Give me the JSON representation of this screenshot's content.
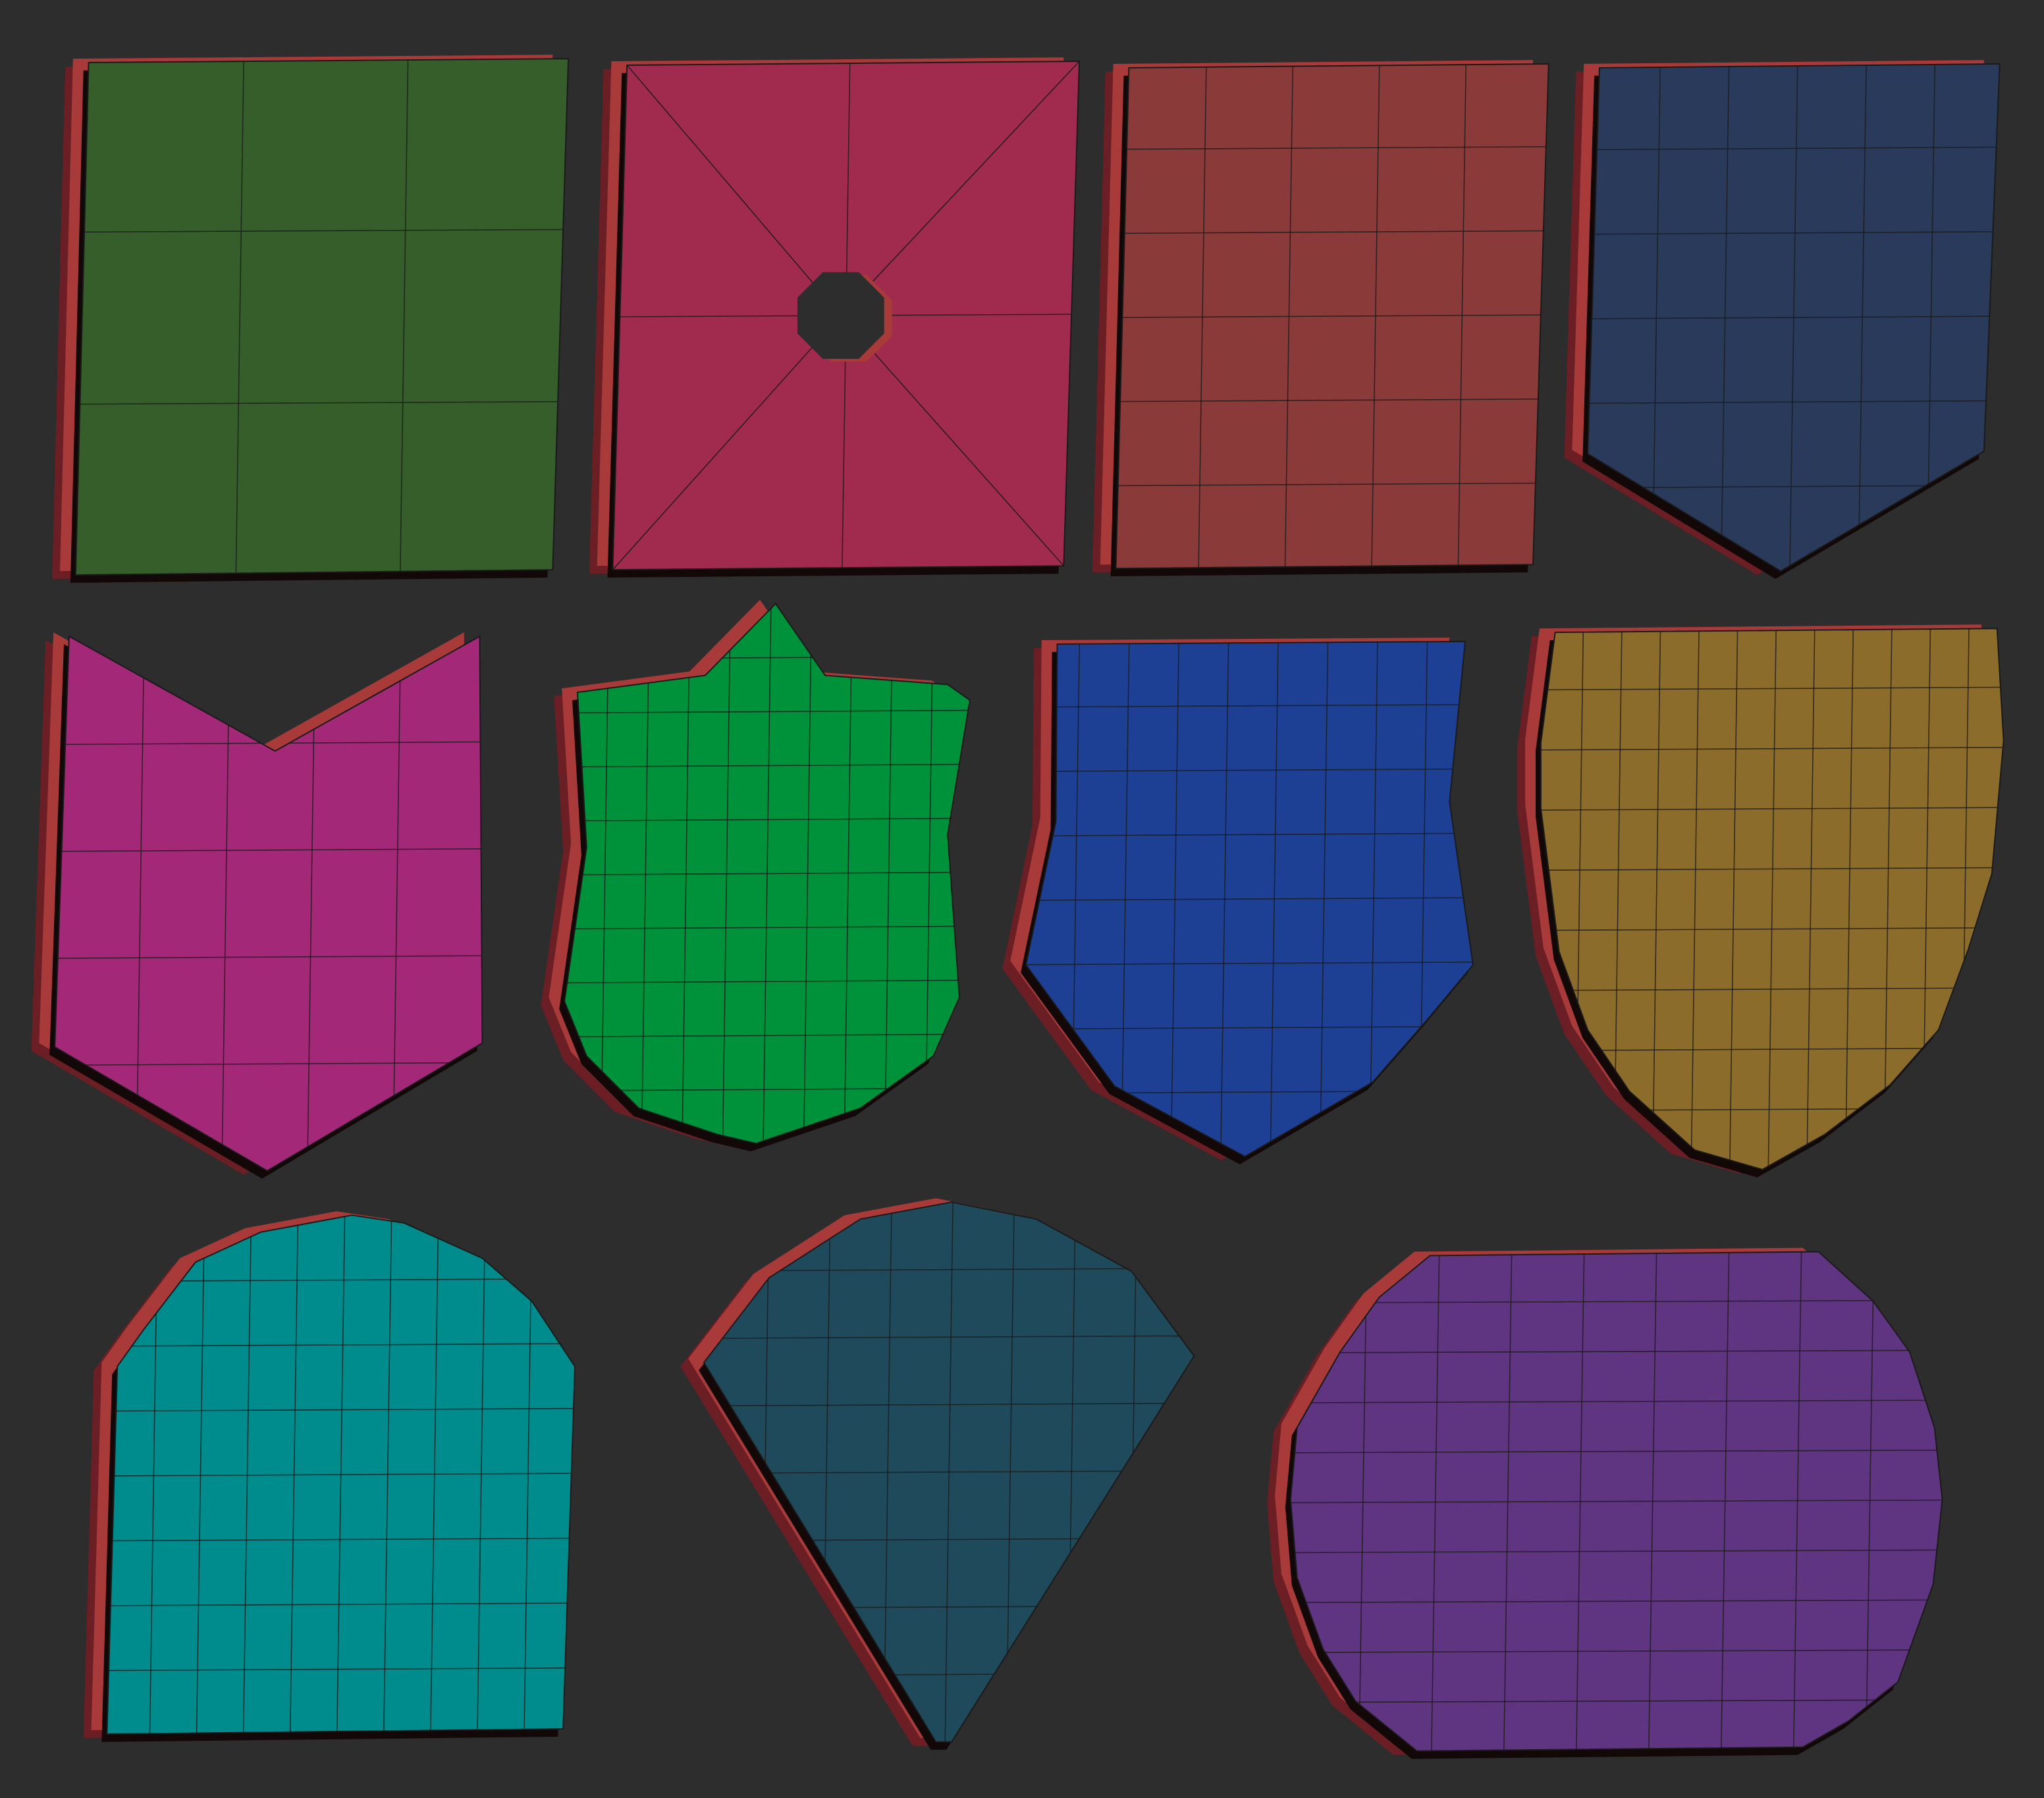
{
  "scene": {
    "background_color": "#2d2d2d",
    "side_color": "#6b1f24",
    "rim_color": "#a83a3a",
    "wire_color": "#1a1a1a"
  },
  "shields": [
    {
      "id": "square-green",
      "face_color": "#365e2b",
      "cols": 3,
      "rows": 3
    },
    {
      "id": "square-hole-pink",
      "face_color": "#a02b4e",
      "cols": 2,
      "rows": 2
    },
    {
      "id": "square-red",
      "face_color": "#8b3a3a",
      "cols": 5,
      "rows": 6
    },
    {
      "id": "pentagon-navy",
      "face_color": "#2a3a5a",
      "cols": 6,
      "rows": 6
    },
    {
      "id": "chevron-magenta",
      "face_color": "#a42878",
      "cols": 5,
      "rows": 5
    },
    {
      "id": "heater-green",
      "face_color": "#00923a",
      "cols": 10,
      "rows": 10
    },
    {
      "id": "heater-blue",
      "face_color": "#1d4095",
      "cols": 9,
      "rows": 8
    },
    {
      "id": "heater-gold",
      "face_color": "#8c6c2a",
      "cols": 12,
      "rows": 9
    },
    {
      "id": "arch-teal",
      "face_color": "#008b8c",
      "cols": 10,
      "rows": 8
    },
    {
      "id": "fan-slate",
      "face_color": "#1f4a5c",
      "cols": 8,
      "rows": 8
    },
    {
      "id": "round-purple",
      "face_color": "#5f3480",
      "cols": 9,
      "rows": 10
    }
  ]
}
